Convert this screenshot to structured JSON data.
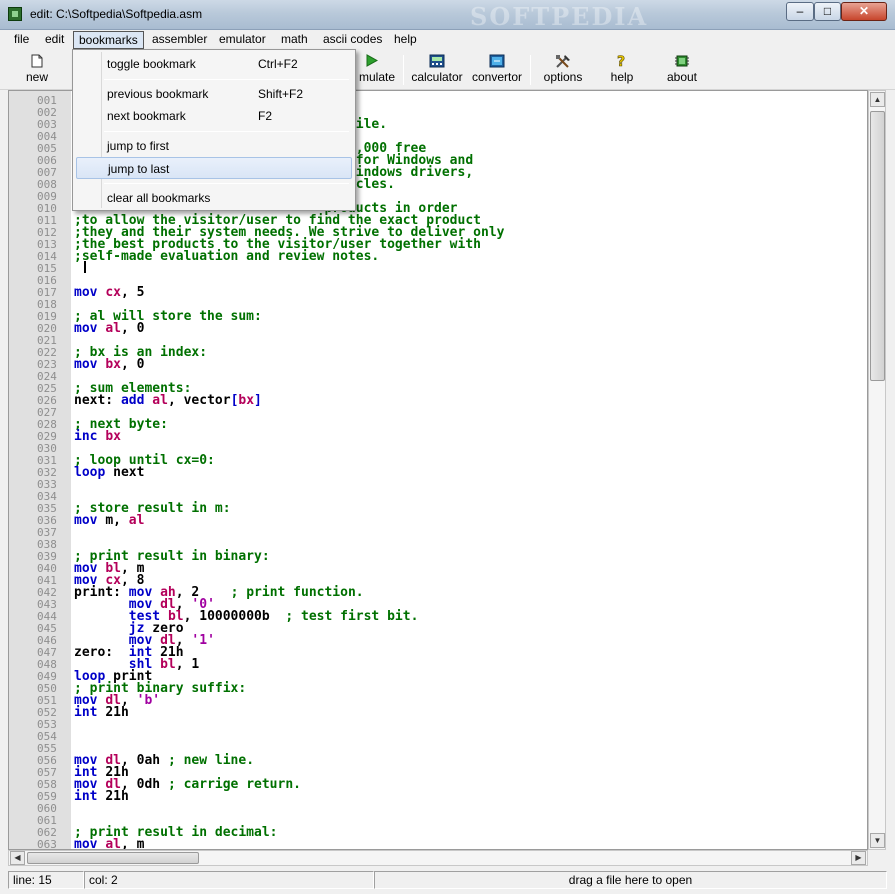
{
  "window": {
    "title": "edit: C:\\Softpedia\\Softpedia.asm",
    "watermark": "SOFTPEDIA",
    "minimize": "–",
    "maximize": "□",
    "close": "✕"
  },
  "menu": [
    "file",
    "edit",
    "bookmarks",
    "assembler",
    "emulator",
    "math",
    "ascii codes",
    "help"
  ],
  "toolbar": {
    "new": "new",
    "emulate": "mulate",
    "calculator": "calculator",
    "convertor": "convertor",
    "options": "options",
    "help": "help",
    "about": "about"
  },
  "bookmarks_menu": [
    {
      "label": "toggle bookmark",
      "shortcut": "Ctrl+F2"
    },
    {
      "label": "previous bookmark",
      "shortcut": "Shift+F2"
    },
    {
      "label": "next bookmark",
      "shortcut": "F2"
    },
    {
      "label": "jump to first",
      "shortcut": ""
    },
    {
      "label": "jump to last",
      "shortcut": ""
    },
    {
      "label": "clear all bookmarks",
      "shortcut": ""
    }
  ],
  "code_lines": [
    {
      "n": "001",
      "p": []
    },
    {
      "n": "002",
      "p": []
    },
    {
      "n": "003",
      "p": [
        [
          "cm",
          "                                om file."
        ]
      ]
    },
    {
      "n": "004",
      "p": []
    },
    {
      "n": "005",
      "p": [
        [
          "cm",
          "                                 400,000 free"
        ]
      ]
    },
    {
      "n": "006",
      "p": [
        [
          "cm",
          "                                ams for Windows and"
        ]
      ]
    },
    {
      "n": "007",
      "p": [
        [
          "cm",
          "                                e, Windows drivers,"
        ]
      ]
    },
    {
      "n": "008",
      "p": [
        [
          "cm",
          "                                articles."
        ]
      ]
    },
    {
      "n": "009",
      "p": []
    },
    {
      "n": "010",
      "p": [
        [
          "cm",
          "                                products in order"
        ]
      ]
    },
    {
      "n": "011",
      "p": [
        [
          "cm",
          ";to allow the visitor/user to find the exact product"
        ]
      ]
    },
    {
      "n": "012",
      "p": [
        [
          "cm",
          ";they and their system needs. We strive to deliver only"
        ]
      ]
    },
    {
      "n": "013",
      "p": [
        [
          "cm",
          ";the best products to the visitor/user together with"
        ]
      ]
    },
    {
      "n": "014",
      "p": [
        [
          "cm",
          ";self-made evaluation and review notes."
        ]
      ]
    },
    {
      "n": "015",
      "p": []
    },
    {
      "n": "016",
      "p": []
    },
    {
      "n": "017",
      "p": [
        [
          "kw",
          "mov "
        ],
        [
          "rg",
          "cx"
        ],
        [
          "tx",
          ", 5"
        ]
      ]
    },
    {
      "n": "018",
      "p": []
    },
    {
      "n": "019",
      "p": [
        [
          "cm",
          "; al will store the sum:"
        ]
      ]
    },
    {
      "n": "020",
      "p": [
        [
          "kw",
          "mov "
        ],
        [
          "rg",
          "al"
        ],
        [
          "tx",
          ", 0"
        ]
      ]
    },
    {
      "n": "021",
      "p": []
    },
    {
      "n": "022",
      "p": [
        [
          "cm",
          "; bx is an index:"
        ]
      ]
    },
    {
      "n": "023",
      "p": [
        [
          "kw",
          "mov "
        ],
        [
          "rg",
          "bx"
        ],
        [
          "tx",
          ", 0"
        ]
      ]
    },
    {
      "n": "024",
      "p": []
    },
    {
      "n": "025",
      "p": [
        [
          "cm",
          "; sum elements:"
        ]
      ]
    },
    {
      "n": "026",
      "p": [
        [
          "tx",
          "next: "
        ],
        [
          "kw",
          "add "
        ],
        [
          "rg",
          "al"
        ],
        [
          "tx",
          ", vector"
        ],
        [
          "kw",
          "["
        ],
        [
          "rg",
          "bx"
        ],
        [
          "kw",
          "]"
        ]
      ]
    },
    {
      "n": "027",
      "p": []
    },
    {
      "n": "028",
      "p": [
        [
          "cm",
          "; next byte:"
        ]
      ]
    },
    {
      "n": "029",
      "p": [
        [
          "kw",
          "inc "
        ],
        [
          "rg",
          "bx"
        ]
      ]
    },
    {
      "n": "030",
      "p": []
    },
    {
      "n": "031",
      "p": [
        [
          "cm",
          "; loop until cx=0:"
        ]
      ]
    },
    {
      "n": "032",
      "p": [
        [
          "kw",
          "loop "
        ],
        [
          "tx",
          "next"
        ]
      ]
    },
    {
      "n": "033",
      "p": []
    },
    {
      "n": "034",
      "p": []
    },
    {
      "n": "035",
      "p": [
        [
          "cm",
          "; store result in m:"
        ]
      ]
    },
    {
      "n": "036",
      "p": [
        [
          "kw",
          "mov "
        ],
        [
          "tx",
          "m, "
        ],
        [
          "rg",
          "al"
        ]
      ]
    },
    {
      "n": "037",
      "p": []
    },
    {
      "n": "038",
      "p": []
    },
    {
      "n": "039",
      "p": [
        [
          "cm",
          "; print result in binary:"
        ]
      ]
    },
    {
      "n": "040",
      "p": [
        [
          "kw",
          "mov "
        ],
        [
          "rg",
          "bl"
        ],
        [
          "tx",
          ", m"
        ]
      ]
    },
    {
      "n": "041",
      "p": [
        [
          "kw",
          "mov "
        ],
        [
          "rg",
          "cx"
        ],
        [
          "tx",
          ", 8"
        ]
      ]
    },
    {
      "n": "042",
      "p": [
        [
          "tx",
          "print: "
        ],
        [
          "kw",
          "mov "
        ],
        [
          "rg",
          "ah"
        ],
        [
          "tx",
          ", 2    "
        ],
        [
          "cm",
          "; print function."
        ]
      ]
    },
    {
      "n": "043",
      "p": [
        [
          "tx",
          "       "
        ],
        [
          "kw",
          "mov "
        ],
        [
          "rg",
          "dl"
        ],
        [
          "tx",
          ", "
        ],
        [
          "st",
          "'0'"
        ]
      ]
    },
    {
      "n": "044",
      "p": [
        [
          "tx",
          "       "
        ],
        [
          "kw",
          "test "
        ],
        [
          "rg",
          "bl"
        ],
        [
          "tx",
          ", 10000000b  "
        ],
        [
          "cm",
          "; test first bit."
        ]
      ]
    },
    {
      "n": "045",
      "p": [
        [
          "tx",
          "       "
        ],
        [
          "kw",
          "jz "
        ],
        [
          "tx",
          "zero"
        ]
      ]
    },
    {
      "n": "046",
      "p": [
        [
          "tx",
          "       "
        ],
        [
          "kw",
          "mov "
        ],
        [
          "rg",
          "dl"
        ],
        [
          "tx",
          ", "
        ],
        [
          "st",
          "'1'"
        ]
      ]
    },
    {
      "n": "047",
      "p": [
        [
          "tx",
          "zero:  "
        ],
        [
          "kw",
          "int "
        ],
        [
          "tx",
          "21h"
        ]
      ]
    },
    {
      "n": "048",
      "p": [
        [
          "tx",
          "       "
        ],
        [
          "kw",
          "shl "
        ],
        [
          "rg",
          "bl"
        ],
        [
          "tx",
          ", 1"
        ]
      ]
    },
    {
      "n": "049",
      "p": [
        [
          "kw",
          "loop "
        ],
        [
          "tx",
          "print"
        ]
      ]
    },
    {
      "n": "050",
      "p": [
        [
          "cm",
          "; print binary suffix:"
        ]
      ]
    },
    {
      "n": "051",
      "p": [
        [
          "kw",
          "mov "
        ],
        [
          "rg",
          "dl"
        ],
        [
          "tx",
          ", "
        ],
        [
          "st",
          "'b'"
        ]
      ]
    },
    {
      "n": "052",
      "p": [
        [
          "kw",
          "int "
        ],
        [
          "tx",
          "21h"
        ]
      ]
    },
    {
      "n": "053",
      "p": []
    },
    {
      "n": "054",
      "p": []
    },
    {
      "n": "055",
      "p": []
    },
    {
      "n": "056",
      "p": [
        [
          "kw",
          "mov "
        ],
        [
          "rg",
          "dl"
        ],
        [
          "tx",
          ", 0ah "
        ],
        [
          "cm",
          "; new line."
        ]
      ]
    },
    {
      "n": "057",
      "p": [
        [
          "kw",
          "int "
        ],
        [
          "tx",
          "21h"
        ]
      ]
    },
    {
      "n": "058",
      "p": [
        [
          "kw",
          "mov "
        ],
        [
          "rg",
          "dl"
        ],
        [
          "tx",
          ", 0dh "
        ],
        [
          "cm",
          "; carrige return."
        ]
      ]
    },
    {
      "n": "059",
      "p": [
        [
          "kw",
          "int "
        ],
        [
          "tx",
          "21h"
        ]
      ]
    },
    {
      "n": "060",
      "p": []
    },
    {
      "n": "061",
      "p": []
    },
    {
      "n": "062",
      "p": [
        [
          "cm",
          "; print result in decimal:"
        ]
      ]
    },
    {
      "n": "063",
      "p": [
        [
          "kw",
          "mov "
        ],
        [
          "rg",
          "al"
        ],
        [
          "tx",
          ", m"
        ]
      ]
    }
  ],
  "status": {
    "line": "line: 15",
    "col": "col: 2",
    "drag": "drag a file here to open"
  }
}
